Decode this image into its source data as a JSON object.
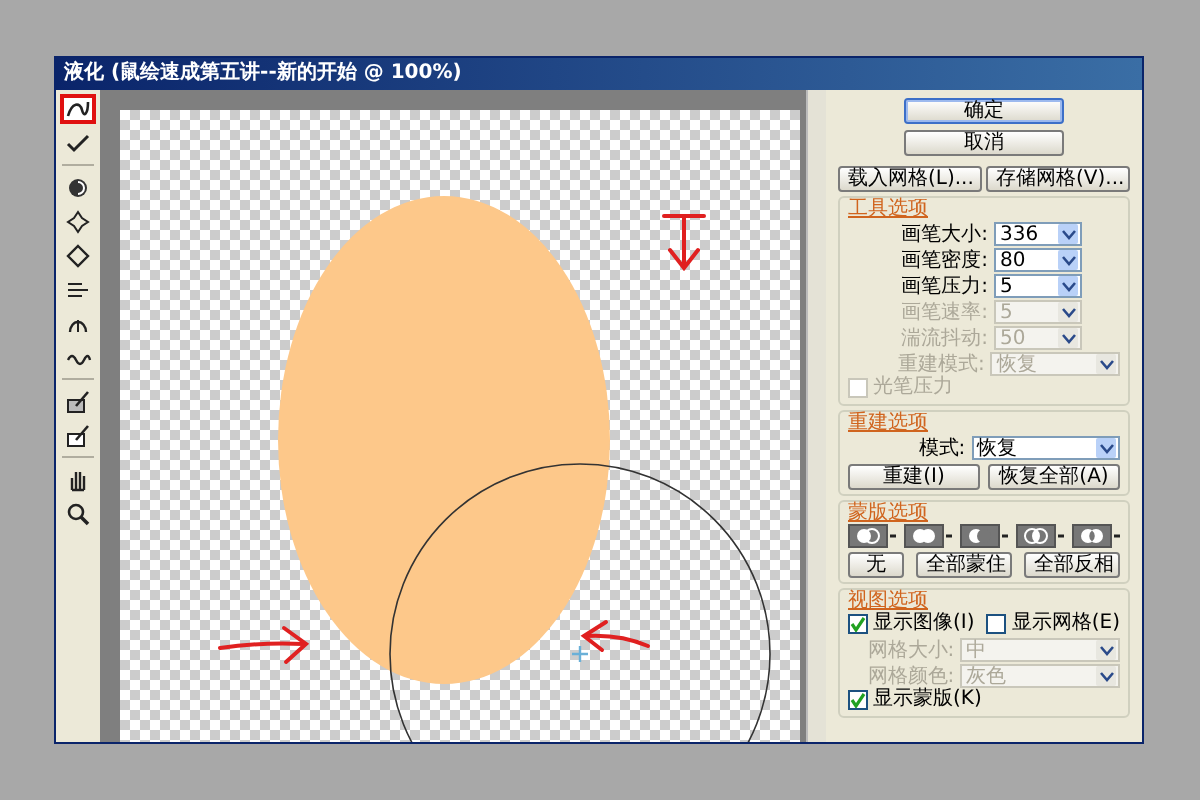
{
  "window": {
    "title": "液化 (鼠绘速成第五讲--新的开始 @ 100%)"
  },
  "tools": [
    {
      "kind": "warp",
      "selected": true
    },
    {
      "kind": "reconstruct",
      "selected": false
    },
    {
      "kind": "twirl",
      "selected": false
    },
    {
      "kind": "pucker",
      "selected": false
    },
    {
      "kind": "bloat",
      "selected": false
    },
    {
      "kind": "push",
      "selected": false
    },
    {
      "kind": "mirror",
      "selected": false
    },
    {
      "kind": "turbulence",
      "selected": false
    },
    {
      "kind": "freeze",
      "selected": false
    },
    {
      "kind": "thaw",
      "selected": false
    },
    {
      "kind": "hand",
      "selected": false
    },
    {
      "kind": "zoom",
      "selected": false
    }
  ],
  "actions": [
    {
      "label": "确定",
      "default": true
    },
    {
      "label": "取消",
      "default": false
    }
  ],
  "mesh_buttons": [
    "载入网格(L)...",
    "存储网格(V)..."
  ],
  "tool_options": {
    "title": "工具选项",
    "fields": [
      {
        "label": "画笔大小:",
        "value": "336",
        "disabled": false
      },
      {
        "label": "画笔密度:",
        "value": "80",
        "disabled": false
      },
      {
        "label": "画笔压力:",
        "value": "5",
        "disabled": false
      },
      {
        "label": "画笔速率:",
        "value": "5",
        "disabled": true
      },
      {
        "label": "湍流抖动:",
        "value": "50",
        "disabled": true
      }
    ],
    "reconstruct_mode": {
      "label": "重建模式:",
      "value": "恢复",
      "disabled": true
    },
    "stylus_pressure": {
      "label": "光笔压力",
      "checked": false,
      "disabled": true
    }
  },
  "reconstruct_options": {
    "title": "重建选项",
    "mode": {
      "label": "模式:",
      "value": "恢复"
    },
    "buttons": [
      "重建(I)",
      "恢复全部(A)"
    ]
  },
  "mask_options": {
    "title": "蒙版选项",
    "modes": [
      {
        "kind": "replace"
      },
      {
        "kind": "add"
      },
      {
        "kind": "subtract"
      },
      {
        "kind": "intersect"
      },
      {
        "kind": "invert"
      }
    ],
    "buttons": [
      "无",
      "全部蒙住",
      "全部反相"
    ]
  },
  "view_options": {
    "title": "视图选项",
    "show_image": {
      "label": "显示图像(I)",
      "checked": true
    },
    "show_mesh": {
      "label": "显示网格(E)",
      "checked": false
    },
    "mesh_size": {
      "label": "网格大小:",
      "value": "中",
      "disabled": true
    },
    "mesh_color": {
      "label": "网格颜色:",
      "value": "灰色",
      "disabled": true
    },
    "show_mask": {
      "label": "显示蒙版(K)",
      "checked": true
    }
  }
}
